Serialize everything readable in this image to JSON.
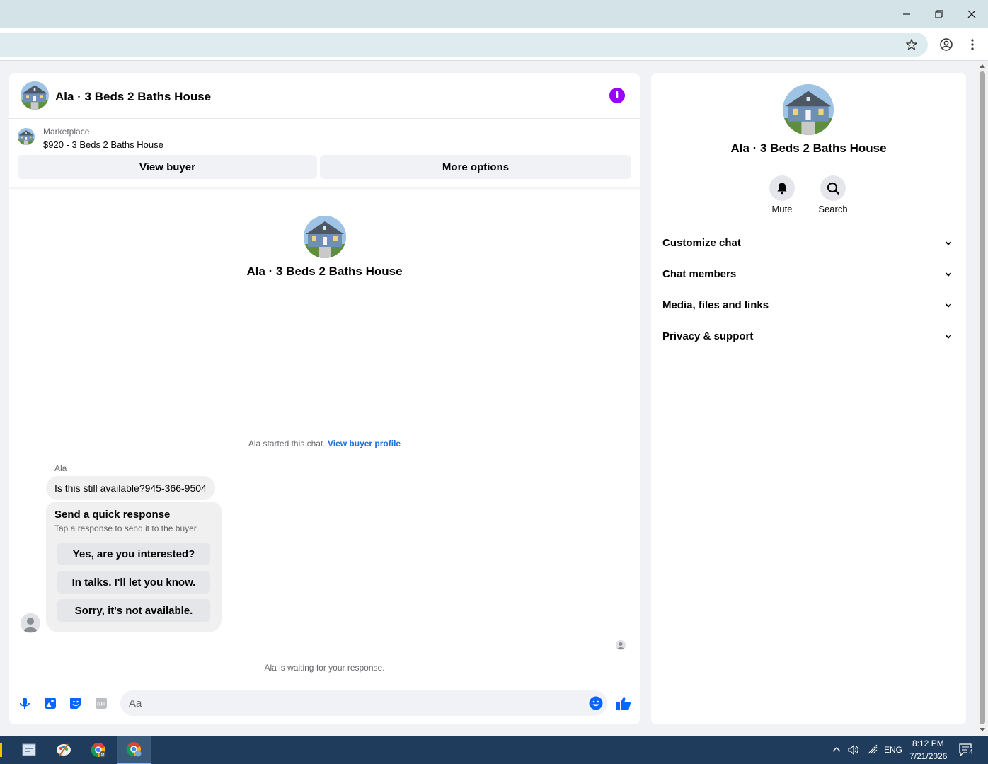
{
  "browser": {
    "window_controls": [
      "minimize",
      "restore",
      "close"
    ]
  },
  "chat": {
    "header_title": "Ala · 3 Beds 2 Baths House",
    "marketplace_label": "Marketplace",
    "listing": "$920 - 3 Beds 2 Baths House",
    "view_buyer_label": "View buyer",
    "more_options_label": "More options",
    "profile_name": "Ala · 3 Beds 2 Baths House",
    "started_text": "Ala started this chat.",
    "view_buyer_profile_label": "View buyer profile",
    "sender_name": "Ala",
    "message": "Is this still available?945-366-9504",
    "quick_response": {
      "title": "Send a quick response",
      "subtitle": "Tap a response to send it to the buyer.",
      "options": [
        "Yes, are you interested?",
        "In talks. I'll let you know.",
        "Sorry, it's not available."
      ]
    },
    "waiting_text": "Ala is waiting for your response.",
    "composer_placeholder": "Aa",
    "accent_color": "#0866ff"
  },
  "info_panel": {
    "name": "Ala · 3 Beds 2 Baths House",
    "actions": [
      {
        "label": "Mute",
        "icon": "bell-icon"
      },
      {
        "label": "Search",
        "icon": "search-icon"
      }
    ],
    "sections": [
      "Customize chat",
      "Chat members",
      "Media, files and links",
      "Privacy & support"
    ]
  },
  "taskbar": {
    "language": "ENG",
    "time": "8:12 PM",
    "date": "7/21/2026",
    "notification_count": "4"
  }
}
